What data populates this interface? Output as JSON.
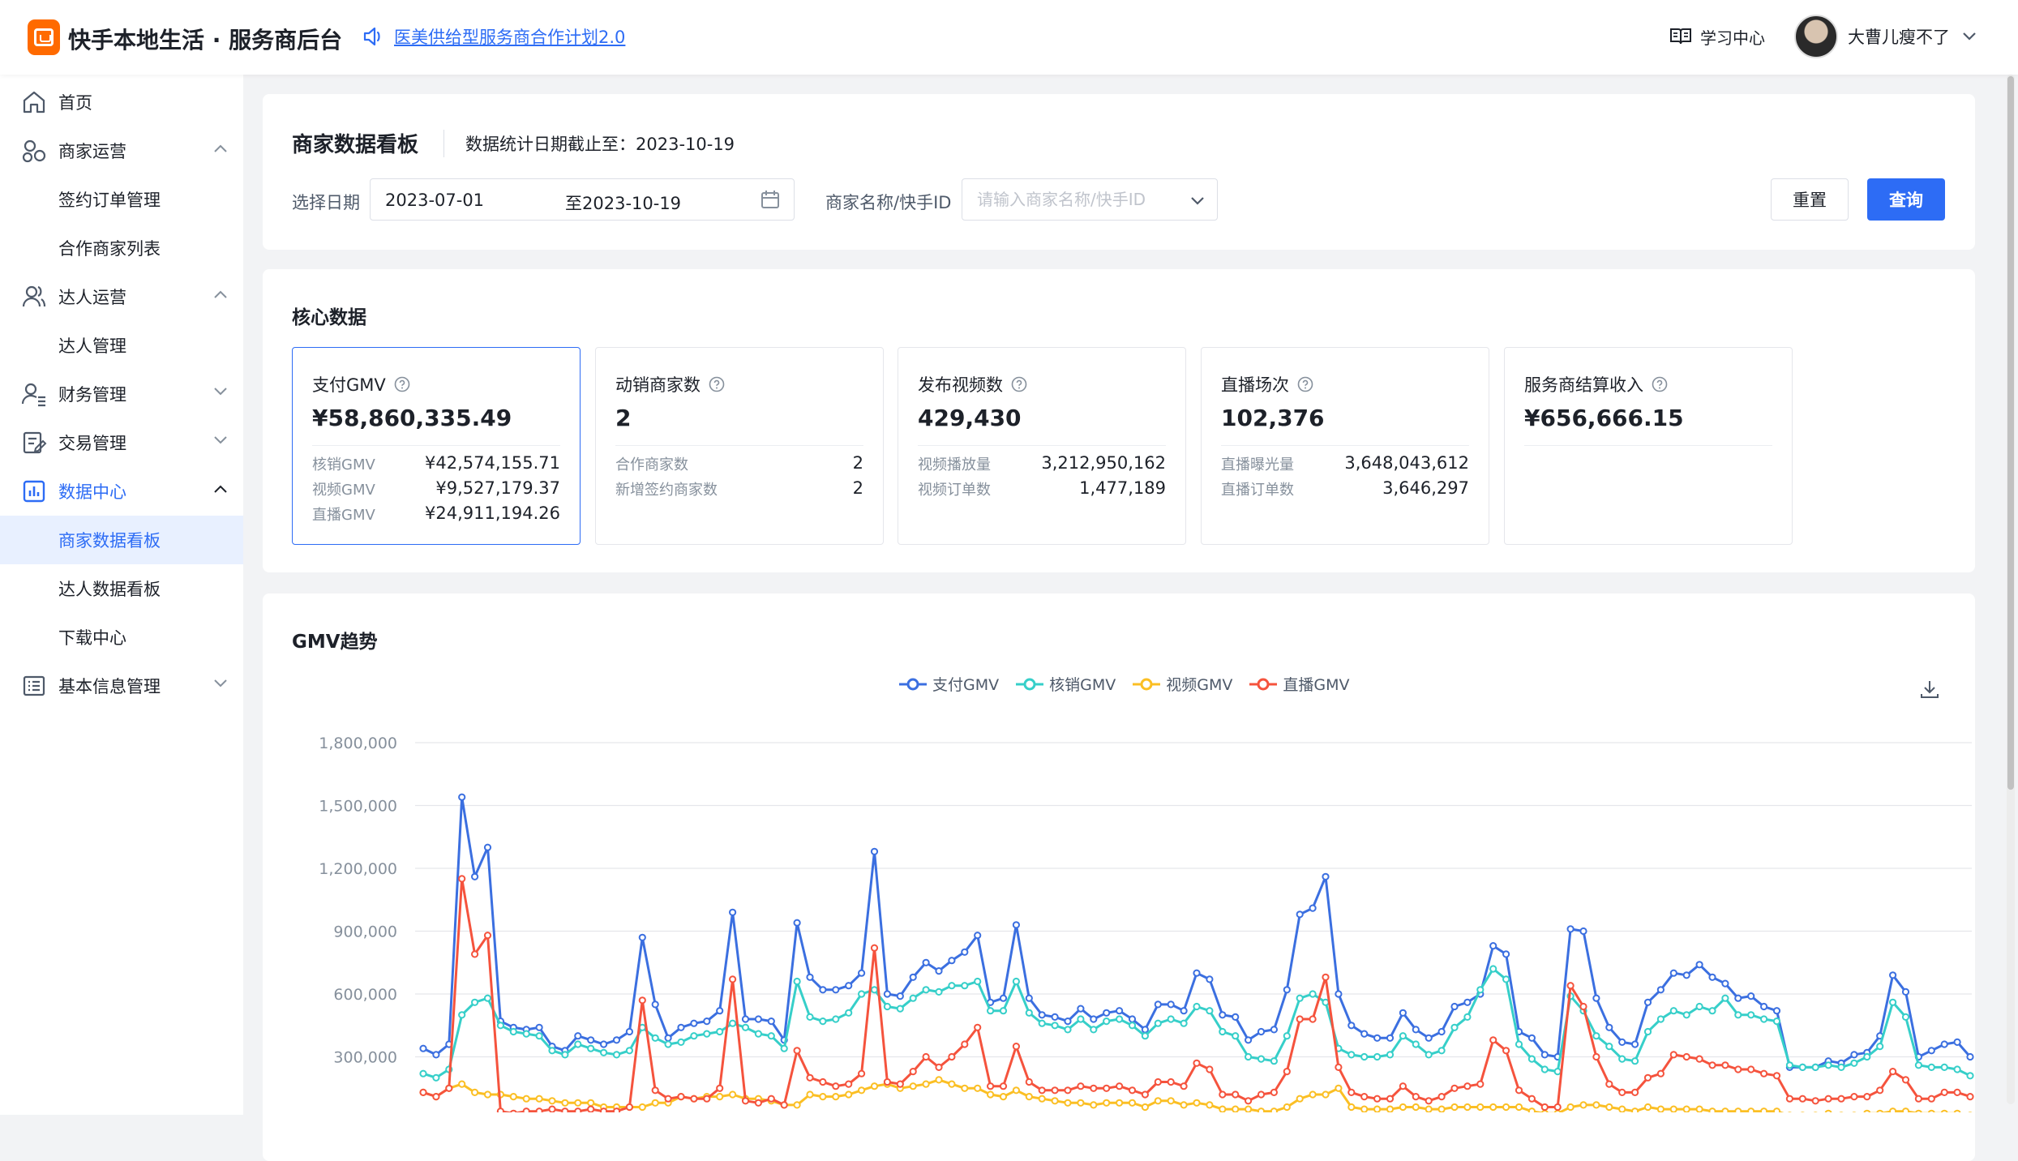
{
  "header": {
    "brand": "快手本地生活 · 服务商后台",
    "notice_link": "医美供给型服务商合作计划2.0",
    "learning_center": "学习中心",
    "user_name": "大曹儿瘦不了"
  },
  "sidebar": {
    "items": [
      {
        "label": "首页",
        "icon": "home-icon"
      },
      {
        "label": "商家运营",
        "icon": "merchant-ops-icon",
        "expanded": true
      },
      {
        "label": "签约订单管理"
      },
      {
        "label": "合作商家列表"
      },
      {
        "label": "达人运营",
        "icon": "influencer-icon",
        "expanded": true
      },
      {
        "label": "达人管理"
      },
      {
        "label": "财务管理",
        "icon": "finance-icon",
        "expanded": false
      },
      {
        "label": "交易管理",
        "icon": "transaction-icon",
        "expanded": false
      },
      {
        "label": "数据中心",
        "icon": "data-center-icon",
        "expanded": true
      },
      {
        "label": "商家数据看板",
        "active": true
      },
      {
        "label": "达人数据看板"
      },
      {
        "label": "下载中心"
      },
      {
        "label": "基本信息管理",
        "icon": "basic-info-icon",
        "expanded": false
      }
    ]
  },
  "filter": {
    "page_title": "商家数据看板",
    "deadline": "数据统计日期截止至：2023-10-19",
    "date_label": "选择日期",
    "start_date": "2023-07-01",
    "end_date": "至2023-10-19",
    "merchant_label": "商家名称/快手ID",
    "merchant_placeholder": "请输入商家名称/快手ID",
    "reset": "重置",
    "query": "查询"
  },
  "core": {
    "title": "核心数据",
    "kpis": [
      {
        "name": "支付GMV",
        "value": "¥58,860,335.49",
        "selected": true,
        "rows": [
          {
            "label": "核销GMV",
            "value": "¥42,574,155.71"
          },
          {
            "label": "视频GMV",
            "value": "¥9,527,179.37"
          },
          {
            "label": "直播GMV",
            "value": "¥24,911,194.26"
          }
        ]
      },
      {
        "name": "动销商家数",
        "value": "2",
        "rows": [
          {
            "label": "合作商家数",
            "value": "2"
          },
          {
            "label": "新增签约商家数",
            "value": "2"
          }
        ]
      },
      {
        "name": "发布视频数",
        "value": "429,430",
        "rows": [
          {
            "label": "视频播放量",
            "value": "3,212,950,162"
          },
          {
            "label": "视频订单数",
            "value": "1,477,189"
          }
        ]
      },
      {
        "name": "直播场次",
        "value": "102,376",
        "rows": [
          {
            "label": "直播曝光量",
            "value": "3,648,043,612"
          },
          {
            "label": "直播订单数",
            "value": "3,646,297"
          }
        ]
      },
      {
        "name": "服务商结算收入",
        "value": "¥656,666.15",
        "rows": []
      }
    ]
  },
  "colors": {
    "accent": "#2d6cf5",
    "gmv": "#3b6fe0",
    "verify": "#36cfc9",
    "video": "#fbbf24",
    "live": "#f5533d"
  },
  "chart_data": {
    "type": "line",
    "title": "GMV趋势",
    "xlabel": "",
    "ylabel": "",
    "ylim": [
      0,
      1800000
    ],
    "yticks": [
      "300,000",
      "600,000",
      "900,000",
      "1,200,000",
      "1,500,000",
      "1,800,000"
    ],
    "grid": true,
    "legend_position": "top-center",
    "series": [
      {
        "name": "支付GMV",
        "values": [
          340000,
          310000,
          360000,
          1540000,
          1160000,
          1300000,
          470000,
          440000,
          430000,
          440000,
          350000,
          330000,
          400000,
          380000,
          360000,
          380000,
          420000,
          870000,
          550000,
          390000,
          440000,
          460000,
          470000,
          520000,
          990000,
          480000,
          480000,
          470000,
          380000,
          940000,
          680000,
          620000,
          620000,
          640000,
          700000,
          1280000,
          600000,
          590000,
          680000,
          750000,
          710000,
          760000,
          800000,
          880000,
          560000,
          580000,
          930000,
          580000,
          500000,
          490000,
          470000,
          530000,
          480000,
          510000,
          520000,
          480000,
          430000,
          550000,
          550000,
          520000,
          700000,
          670000,
          500000,
          490000,
          380000,
          420000,
          430000,
          620000,
          980000,
          1010000,
          1160000,
          600000,
          450000,
          410000,
          390000,
          390000,
          510000,
          430000,
          390000,
          420000,
          540000,
          560000,
          600000,
          830000,
          790000,
          420000,
          390000,
          310000,
          300000,
          910000,
          900000,
          580000,
          440000,
          370000,
          360000,
          560000,
          620000,
          700000,
          690000,
          740000,
          680000,
          650000,
          580000,
          590000,
          540000,
          520000,
          250000,
          250000,
          250000,
          280000,
          270000,
          310000,
          320000,
          400000,
          690000,
          610000,
          300000,
          330000,
          360000,
          370000,
          300000
        ]
      },
      {
        "name": "核销GMV",
        "values": [
          220000,
          200000,
          240000,
          500000,
          560000,
          580000,
          450000,
          420000,
          410000,
          400000,
          330000,
          310000,
          360000,
          340000,
          320000,
          310000,
          330000,
          440000,
          390000,
          360000,
          370000,
          400000,
          410000,
          420000,
          460000,
          440000,
          410000,
          400000,
          340000,
          660000,
          490000,
          470000,
          480000,
          510000,
          600000,
          620000,
          540000,
          530000,
          580000,
          620000,
          610000,
          640000,
          640000,
          660000,
          520000,
          520000,
          660000,
          510000,
          460000,
          450000,
          430000,
          480000,
          430000,
          470000,
          480000,
          450000,
          400000,
          460000,
          480000,
          460000,
          540000,
          520000,
          420000,
          400000,
          300000,
          290000,
          280000,
          400000,
          580000,
          600000,
          560000,
          340000,
          310000,
          300000,
          300000,
          310000,
          400000,
          360000,
          310000,
          330000,
          440000,
          490000,
          620000,
          720000,
          670000,
          360000,
          290000,
          240000,
          230000,
          590000,
          520000,
          400000,
          350000,
          290000,
          280000,
          420000,
          480000,
          520000,
          500000,
          540000,
          520000,
          580000,
          500000,
          500000,
          480000,
          470000,
          260000,
          250000,
          250000,
          260000,
          250000,
          270000,
          300000,
          350000,
          560000,
          490000,
          260000,
          250000,
          250000,
          240000,
          210000
        ]
      },
      {
        "name": "视频GMV",
        "values": [
          130000,
          110000,
          150000,
          170000,
          130000,
          120000,
          120000,
          110000,
          100000,
          100000,
          90000,
          80000,
          80000,
          80000,
          60000,
          60000,
          60000,
          60000,
          80000,
          80000,
          110000,
          100000,
          110000,
          110000,
          120000,
          100000,
          100000,
          90000,
          70000,
          70000,
          120000,
          110000,
          110000,
          120000,
          140000,
          160000,
          170000,
          150000,
          160000,
          170000,
          190000,
          170000,
          150000,
          150000,
          120000,
          110000,
          140000,
          110000,
          100000,
          90000,
          80000,
          80000,
          70000,
          80000,
          80000,
          80000,
          60000,
          90000,
          90000,
          70000,
          80000,
          70000,
          50000,
          50000,
          50000,
          40000,
          40000,
          60000,
          100000,
          120000,
          120000,
          150000,
          60000,
          50000,
          50000,
          50000,
          60000,
          60000,
          50000,
          50000,
          60000,
          60000,
          60000,
          60000,
          60000,
          60000,
          40000,
          30000,
          30000,
          60000,
          70000,
          70000,
          60000,
          50000,
          40000,
          60000,
          50000,
          50000,
          50000,
          50000,
          40000,
          40000,
          40000,
          40000,
          40000,
          40000,
          20000,
          20000,
          20000,
          30000,
          20000,
          20000,
          30000,
          30000,
          40000,
          40000,
          30000,
          30000,
          30000,
          30000,
          20000
        ]
      },
      {
        "name": "直播GMV",
        "values": [
          130000,
          110000,
          150000,
          1150000,
          790000,
          880000,
          40000,
          30000,
          40000,
          40000,
          50000,
          40000,
          40000,
          50000,
          40000,
          40000,
          60000,
          570000,
          140000,
          100000,
          110000,
          100000,
          100000,
          150000,
          670000,
          90000,
          80000,
          100000,
          70000,
          330000,
          200000,
          180000,
          160000,
          170000,
          220000,
          820000,
          180000,
          170000,
          230000,
          300000,
          250000,
          300000,
          360000,
          440000,
          160000,
          160000,
          350000,
          180000,
          140000,
          140000,
          140000,
          160000,
          150000,
          150000,
          160000,
          140000,
          120000,
          180000,
          180000,
          160000,
          270000,
          240000,
          120000,
          120000,
          90000,
          120000,
          130000,
          230000,
          480000,
          480000,
          680000,
          250000,
          130000,
          110000,
          100000,
          100000,
          160000,
          110000,
          90000,
          110000,
          150000,
          160000,
          170000,
          380000,
          330000,
          140000,
          100000,
          60000,
          60000,
          640000,
          540000,
          300000,
          170000,
          130000,
          130000,
          200000,
          220000,
          310000,
          300000,
          290000,
          260000,
          260000,
          240000,
          240000,
          220000,
          210000,
          100000,
          100000,
          90000,
          100000,
          100000,
          110000,
          110000,
          140000,
          230000,
          190000,
          100000,
          100000,
          130000,
          130000,
          110000
        ]
      }
    ]
  }
}
